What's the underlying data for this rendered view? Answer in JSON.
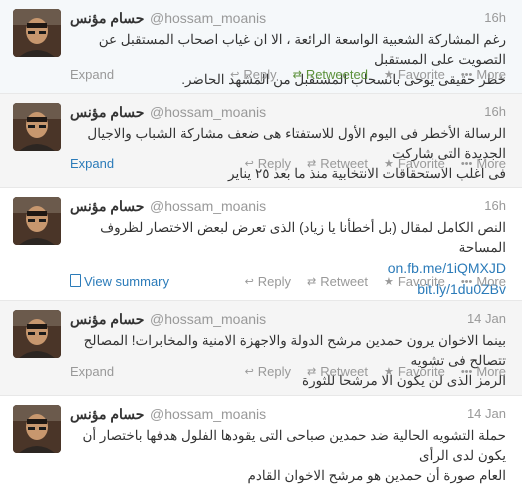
{
  "tweets": [
    {
      "display_name": "حسام مؤنس",
      "handle": "@hossam_moanis",
      "time": "16h",
      "lines": [
        "رغم المشاركة الشعبية الواسعة الرائعة ، الا ان غياب اصحاب المستقبل عن التصويت على المستقبل",
        "خطر حقيقى يوحى بانسحاب المستقبل من المشهد الحاضر."
      ],
      "links": [],
      "expand": "Expand",
      "reply": "Reply",
      "retweet": "Retweeted",
      "favorite": "Favorite",
      "more": "More"
    },
    {
      "display_name": "حسام مؤنس",
      "handle": "@hossam_moanis",
      "time": "16h",
      "lines": [
        "الرسالة الأخطر فى اليوم الأول للاستفتاء هى ضعف مشاركة الشباب والاجيال الجديدة التى شاركت",
        "فى اغلب الاستحقاقات الانتخابية منذ ما بعد ٢٥ يناير"
      ],
      "links": [],
      "expand": "Expand",
      "reply": "Reply",
      "retweet": "Retweet",
      "favorite": "Favorite",
      "more": "More"
    },
    {
      "display_name": "حسام مؤنس",
      "handle": "@hossam_moanis",
      "time": "16h",
      "lines": [
        "النص الكامل لمقال (بل أخطأنا يا زياد) الذى تعرض لبعض الاختصار لظروف المساحة"
      ],
      "links": [
        "on.fb.me/1iQMXJD",
        "bit.ly/1du0ZBv"
      ],
      "expand": "View summary",
      "reply": "Reply",
      "retweet": "Retweet",
      "favorite": "Favorite",
      "more": "More"
    },
    {
      "display_name": "حسام مؤنس",
      "handle": "@hossam_moanis",
      "time": "14 Jan",
      "lines": [
        "بينما الاخوان يرون حمدين مرشح الدولة والاجهزة الامنية والمخابرات! المصالح تتصالح فى تشويه",
        "الرمز الذى لن يكون الا مرشحا للثورة"
      ],
      "links": [],
      "expand": "Expand",
      "reply": "Reply",
      "retweet": "Retweet",
      "favorite": "Favorite",
      "more": "More"
    },
    {
      "display_name": "حسام مؤنس",
      "handle": "@hossam_moanis",
      "time": "14 Jan",
      "lines": [
        "حملة التشويه الحالية ضد حمدين صباحى التى يقودها الفلول هدفها باختصار أن يكون لدى الرأى",
        "العام صورة أن حمدين هو مرشح الاخوان القادم"
      ],
      "links": [],
      "expand": "",
      "reply": "",
      "retweet": "",
      "favorite": "",
      "more": ""
    }
  ],
  "icons": {
    "reply": "reply-icon",
    "retweet": "retweet-icon",
    "favorite": "star-icon",
    "more": "more-dots-icon",
    "summary": "summary-card-icon"
  },
  "colors": {
    "link": "#2b7bb9",
    "retweeted": "#5c913b",
    "muted": "#999999"
  }
}
